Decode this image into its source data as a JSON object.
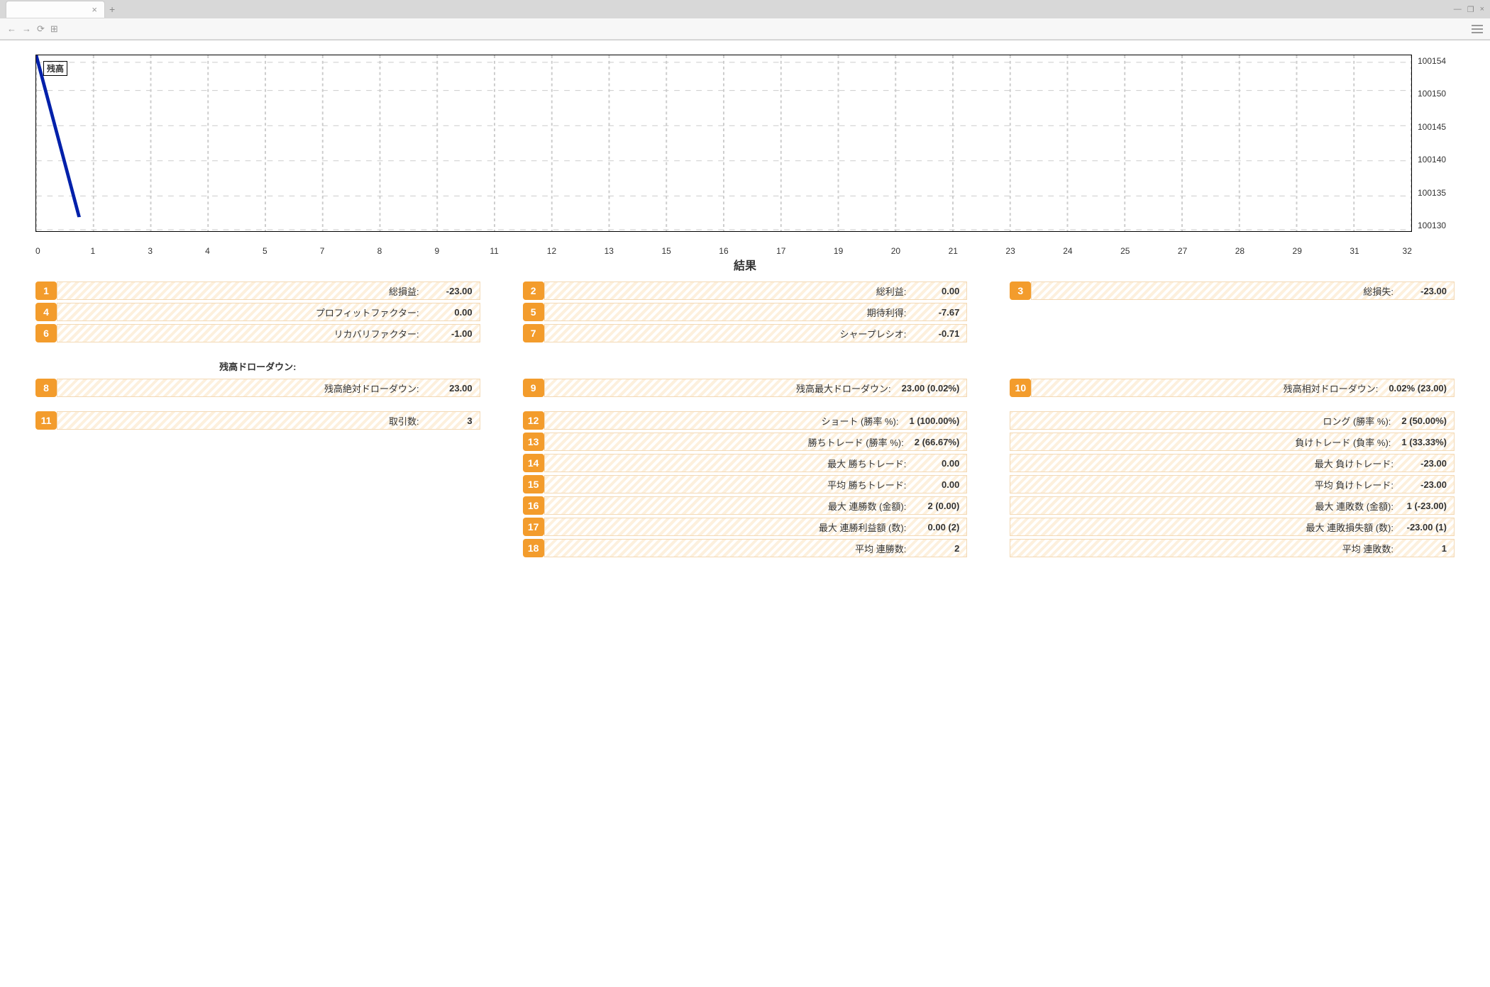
{
  "browser": {
    "tab_close": "×",
    "tab_add": "+",
    "win_min": "—",
    "win_max": "❐",
    "win_close": "×",
    "back": "←",
    "forward": "→",
    "reload": "⟳",
    "apps": "⊞"
  },
  "chart_data": {
    "type": "line",
    "legend": "残高",
    "x": [
      0,
      1
    ],
    "values": [
      100155,
      100132
    ],
    "xticks": [
      "0",
      "1",
      "3",
      "4",
      "5",
      "7",
      "8",
      "9",
      "11",
      "12",
      "13",
      "15",
      "16",
      "17",
      "19",
      "20",
      "21",
      "23",
      "24",
      "25",
      "27",
      "28",
      "29",
      "31",
      "32"
    ],
    "yticks": [
      "100154",
      "100150",
      "100145",
      "100140",
      "100135",
      "100130"
    ],
    "xlim": [
      0,
      32
    ],
    "ylim": [
      100130,
      100155
    ]
  },
  "results_title": "結果",
  "metrics": {
    "r1": {
      "n": "1",
      "label": "総損益:",
      "value": "-23.00"
    },
    "r2": {
      "n": "2",
      "label": "総利益:",
      "value": "0.00"
    },
    "r3": {
      "n": "3",
      "label": "総損失:",
      "value": "-23.00"
    },
    "r4": {
      "n": "4",
      "label": "プロフィットファクター:",
      "value": "0.00"
    },
    "r5": {
      "n": "5",
      "label": "期待利得:",
      "value": "-7.67"
    },
    "r6": {
      "n": "6",
      "label": "リカバリファクター:",
      "value": "-1.00"
    },
    "r7": {
      "n": "7",
      "label": "シャープレシオ:",
      "value": "-0.71"
    },
    "dd_header": "残高ドローダウン:",
    "r8": {
      "n": "8",
      "label": "残高絶対ドローダウン:",
      "value": "23.00"
    },
    "r9": {
      "n": "9",
      "label": "残高最大ドローダウン:",
      "value": "23.00 (0.02%)"
    },
    "r10": {
      "n": "10",
      "label": "残高相対ドローダウン:",
      "value": "0.02% (23.00)"
    },
    "r11": {
      "n": "11",
      "label": "取引数:",
      "value": "3"
    },
    "r12": {
      "n": "12",
      "label": "ショート (勝率 %):",
      "value": "1 (100.00%)"
    },
    "r12b": {
      "label": "ロング (勝率 %):",
      "value": "2 (50.00%)"
    },
    "r13": {
      "n": "13",
      "label": "勝ちトレード (勝率 %):",
      "value": "2 (66.67%)"
    },
    "r13b": {
      "label": "負けトレード (負率 %):",
      "value": "1 (33.33%)"
    },
    "r14": {
      "n": "14",
      "label": "最大 勝ちトレード:",
      "value": "0.00"
    },
    "r14b": {
      "label": "最大 負けトレード:",
      "value": "-23.00"
    },
    "r15": {
      "n": "15",
      "label": "平均 勝ちトレード:",
      "value": "0.00"
    },
    "r15b": {
      "label": "平均 負けトレード:",
      "value": "-23.00"
    },
    "r16": {
      "n": "16",
      "label": "最大 連勝数 (金額):",
      "value": "2 (0.00)"
    },
    "r16b": {
      "label": "最大 連敗数 (金額):",
      "value": "1 (-23.00)"
    },
    "r17": {
      "n": "17",
      "label": "最大 連勝利益額 (数):",
      "value": "0.00 (2)"
    },
    "r17b": {
      "label": "最大 連敗損失額 (数):",
      "value": "-23.00 (1)"
    },
    "r18": {
      "n": "18",
      "label": "平均 連勝数:",
      "value": "2"
    },
    "r18b": {
      "label": "平均 連敗数:",
      "value": "1"
    }
  }
}
